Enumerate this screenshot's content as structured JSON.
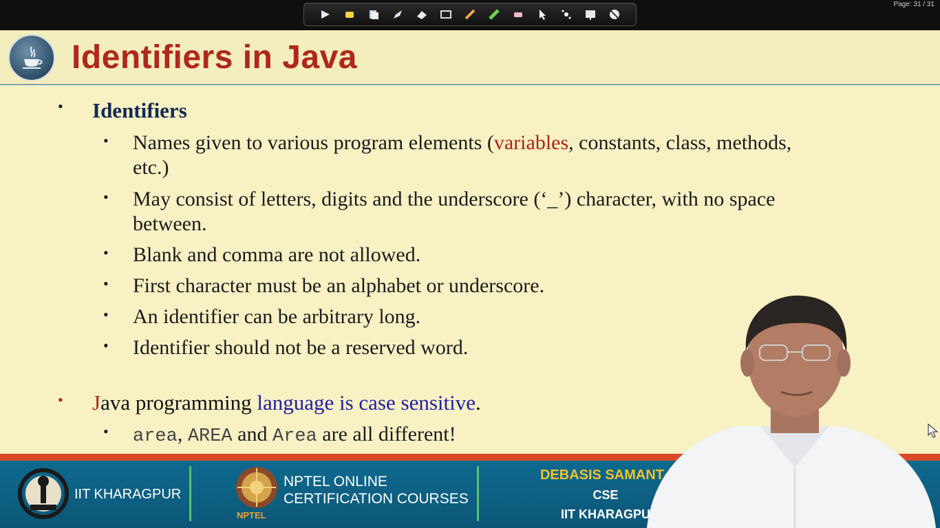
{
  "toolbar": {
    "icons": [
      "arrow-icon",
      "highlighter-icon",
      "pages-icon",
      "pen-icon",
      "eraser-tool-icon",
      "screen-icon",
      "pencil-icon",
      "marker-icon",
      "rubber-icon",
      "pointer-icon",
      "laser-icon",
      "whiteboard-icon",
      "clear-icon"
    ]
  },
  "page_indicator": "Page: 31 / 31",
  "slide": {
    "title": "Identifiers in Java",
    "heading": "Identifiers",
    "items": {
      "i1_pre": "Names given to various program elements (",
      "i1_red": "variables",
      "i1_post": ", constants, class, methods,",
      "i1_line2": "etc.)",
      "i2_line1": "May consist of letters, digits and the underscore (‘_’) character, with no space",
      "i2_line2": "between.",
      "i3": "Blank and comma are not allowed.",
      "i4": "First character must be an alphabet or underscore.",
      "i5": "An identifier can be arbitrary long.",
      "i6": "Identifier should not be a reserved word."
    },
    "java_line": {
      "red_j": "J",
      "black": "ava programming ",
      "blue": "language is case sensitive",
      "end": "."
    },
    "case_line": {
      "m1": "area",
      "t1": ", ",
      "m2": "AREA",
      "t2": " and ",
      "m3": "Area",
      "t3": " are all different!"
    }
  },
  "banner": {
    "iit": "IIT KHARAGPUR",
    "nptel_line1": "NPTEL ONLINE",
    "nptel_line2": "CERTIFICATION COURSES",
    "nptel_logo_text": "NPTEL",
    "speaker_name": "DEBASIS SAMANT",
    "speaker_dept": "CSE",
    "speaker_inst": "IIT KHARAGPU"
  },
  "colors": {
    "title_red": "#b0271c",
    "slide_bg": "#f7f1c4",
    "banner_blue": "#0f6a8f",
    "accent_orange": "#d84a28",
    "speaker_gold": "#f3c12a"
  }
}
